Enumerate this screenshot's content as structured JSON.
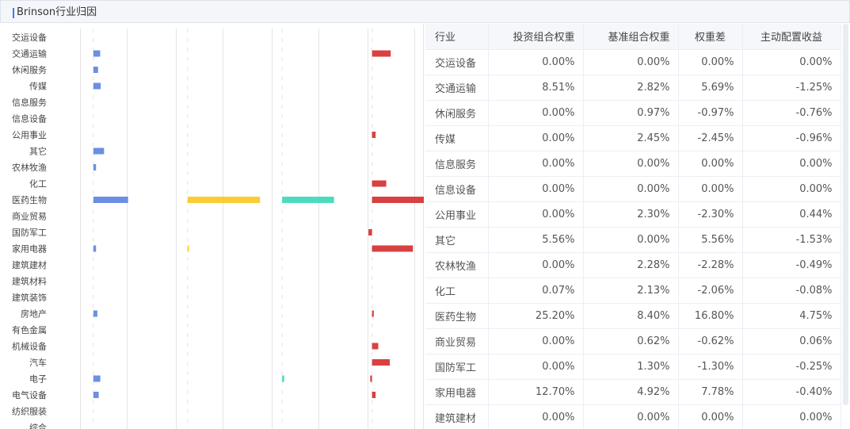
{
  "header": {
    "title": "Brinson行业归因"
  },
  "table": {
    "columns": [
      "行业",
      "投资组合权重",
      "基准组合权重",
      "权重差",
      "主动配置收益"
    ],
    "rows": [
      [
        "交运设备",
        "0.00%",
        "0.00%",
        "0.00%",
        "0.00%"
      ],
      [
        "交通运输",
        "8.51%",
        "2.82%",
        "5.69%",
        "-1.25%"
      ],
      [
        "休闲服务",
        "0.00%",
        "0.97%",
        "-0.97%",
        "-0.76%"
      ],
      [
        "传媒",
        "0.00%",
        "2.45%",
        "-2.45%",
        "-0.96%"
      ],
      [
        "信息服务",
        "0.00%",
        "0.00%",
        "0.00%",
        "0.00%"
      ],
      [
        "信息设备",
        "0.00%",
        "0.00%",
        "0.00%",
        "0.00%"
      ],
      [
        "公用事业",
        "0.00%",
        "2.30%",
        "-2.30%",
        "0.44%"
      ],
      [
        "其它",
        "5.56%",
        "0.00%",
        "5.56%",
        "-1.53%"
      ],
      [
        "农林牧渔",
        "0.00%",
        "2.28%",
        "-2.28%",
        "-0.49%"
      ],
      [
        "化工",
        "0.07%",
        "2.13%",
        "-2.06%",
        "-0.08%"
      ],
      [
        "医药生物",
        "25.20%",
        "8.40%",
        "16.80%",
        "4.75%"
      ],
      [
        "商业贸易",
        "0.00%",
        "0.62%",
        "-0.62%",
        "0.06%"
      ],
      [
        "国防军工",
        "0.00%",
        "1.30%",
        "-1.30%",
        "-0.25%"
      ],
      [
        "家用电器",
        "12.70%",
        "4.92%",
        "7.78%",
        "-0.40%"
      ],
      [
        "建筑建材",
        "0.00%",
        "0.00%",
        "0.00%",
        "0.00%"
      ]
    ]
  },
  "chart_data": {
    "type": "bar",
    "orientation": "horizontal",
    "categories": [
      "交运设备",
      "交通运输",
      "休闲服务",
      "传媒",
      "信息服务",
      "信息设备",
      "公用事业",
      "其它",
      "农林牧渔",
      "化工",
      "医药生物",
      "商业贸易",
      "国防军工",
      "家用电器",
      "建筑建材",
      "建筑材料",
      "建筑装饰",
      "房地产",
      "有色金属",
      "机械设备",
      "汽车",
      "电子",
      "电气设备",
      "纺织服装",
      "综合"
    ],
    "panels": [
      {
        "color": "#6b8fe3",
        "values": [
          0,
          0.51,
          0.35,
          0.55,
          0,
          0,
          0,
          0.8,
          0.2,
          0,
          2.6,
          0,
          0,
          0.2,
          0,
          0,
          0,
          0.3,
          0,
          0,
          0,
          0.52,
          0.4,
          0,
          0
        ],
        "range": [
          -1,
          6
        ]
      },
      {
        "color": "#fbcc33",
        "values": [
          0,
          0,
          0,
          0,
          0,
          0,
          0,
          0,
          0,
          0,
          6.2,
          0,
          0,
          0.12,
          0,
          0,
          0,
          0,
          0,
          0,
          0,
          0,
          0,
          0,
          0
        ],
        "range": [
          -1,
          7
        ]
      },
      {
        "color": "#4ddbbf",
        "values": [
          0,
          0,
          0,
          0,
          0,
          0,
          0,
          0,
          0,
          0,
          5,
          0,
          0,
          0,
          0,
          0,
          0,
          0,
          0,
          0,
          0,
          0.2,
          0,
          0,
          0
        ],
        "range": [
          -1,
          8
        ]
      },
      {
        "color": "#d94040",
        "values": [
          0,
          2.1,
          0,
          0,
          0,
          0,
          0.4,
          0,
          0,
          1.6,
          8.2,
          0,
          -0.4,
          4.6,
          0,
          0,
          0,
          0.2,
          0,
          0.7,
          2,
          -0.2,
          0.4,
          0,
          0
        ],
        "range": [
          -0.5,
          10
        ]
      }
    ]
  }
}
